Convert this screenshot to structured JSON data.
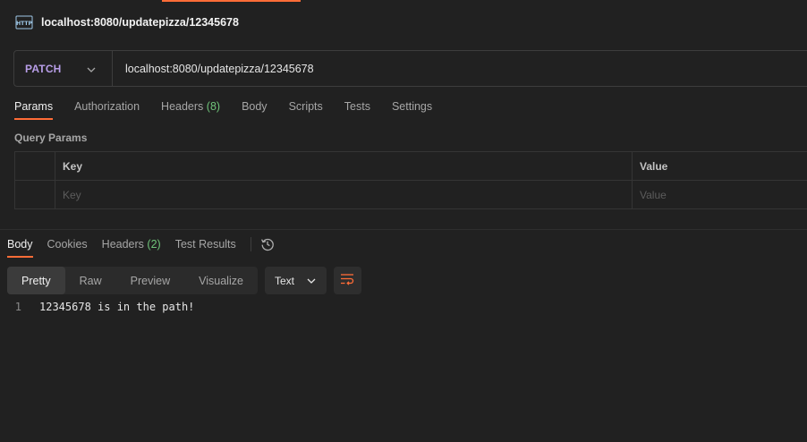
{
  "window": {
    "title": "localhost:8080/updatepizza/12345678",
    "icon": "http-icon"
  },
  "request": {
    "method": "PATCH",
    "url": "localhost:8080/updatepizza/12345678",
    "tabs": [
      {
        "label": "Params",
        "active": true
      },
      {
        "label": "Authorization"
      },
      {
        "label": "Headers",
        "count": "(8)"
      },
      {
        "label": "Body"
      },
      {
        "label": "Scripts"
      },
      {
        "label": "Tests"
      },
      {
        "label": "Settings"
      }
    ],
    "query_params": {
      "title": "Query Params",
      "headers": {
        "key": "Key",
        "value": "Value"
      },
      "placeholder": {
        "key": "Key",
        "value": "Value"
      }
    }
  },
  "response": {
    "tabs": [
      {
        "label": "Body",
        "active": true
      },
      {
        "label": "Cookies"
      },
      {
        "label": "Headers",
        "count": "(2)"
      },
      {
        "label": "Test Results"
      }
    ],
    "view_modes": [
      "Pretty",
      "Raw",
      "Preview",
      "Visualize"
    ],
    "format": "Text",
    "lines": [
      {
        "n": "1",
        "text": "12345678 is in the path!"
      }
    ]
  },
  "colors": {
    "accent": "#ff6c37",
    "method": "#b89ee8",
    "badge": "#6fc47a",
    "background": "#212121"
  }
}
